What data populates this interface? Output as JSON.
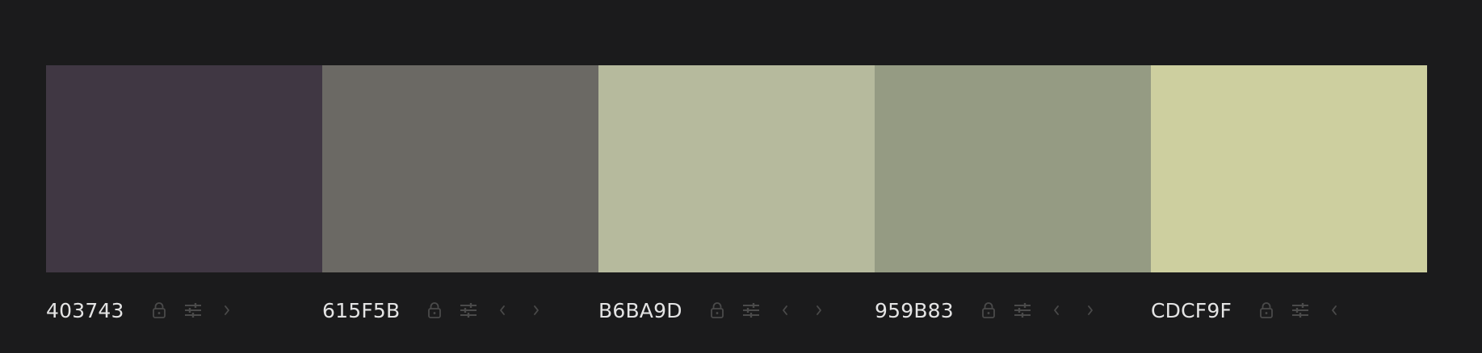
{
  "palette": {
    "colors": [
      {
        "hex": "403743",
        "color": "#403743",
        "icons": [
          "lock-icon",
          "adjust-icon",
          "chevron-right-icon"
        ]
      },
      {
        "hex": "615F5B",
        "color": "#6b6964",
        "icons": [
          "lock-icon",
          "adjust-icon",
          "chevron-left-icon",
          "chevron-right-icon"
        ]
      },
      {
        "hex": "B6BA9D",
        "color": "#b6ba9d",
        "icons": [
          "lock-icon",
          "adjust-icon",
          "chevron-left-icon",
          "chevron-right-icon"
        ]
      },
      {
        "hex": "959B83",
        "color": "#959b83",
        "icons": [
          "lock-icon",
          "adjust-icon",
          "chevron-left-icon",
          "chevron-right-icon"
        ]
      },
      {
        "hex": "CDCF9F",
        "color": "#cdcf9f",
        "icons": [
          "lock-icon",
          "adjust-icon",
          "chevron-left-icon"
        ]
      }
    ],
    "background": "#1b1b1c",
    "icon_color": "#4a4a4a"
  }
}
